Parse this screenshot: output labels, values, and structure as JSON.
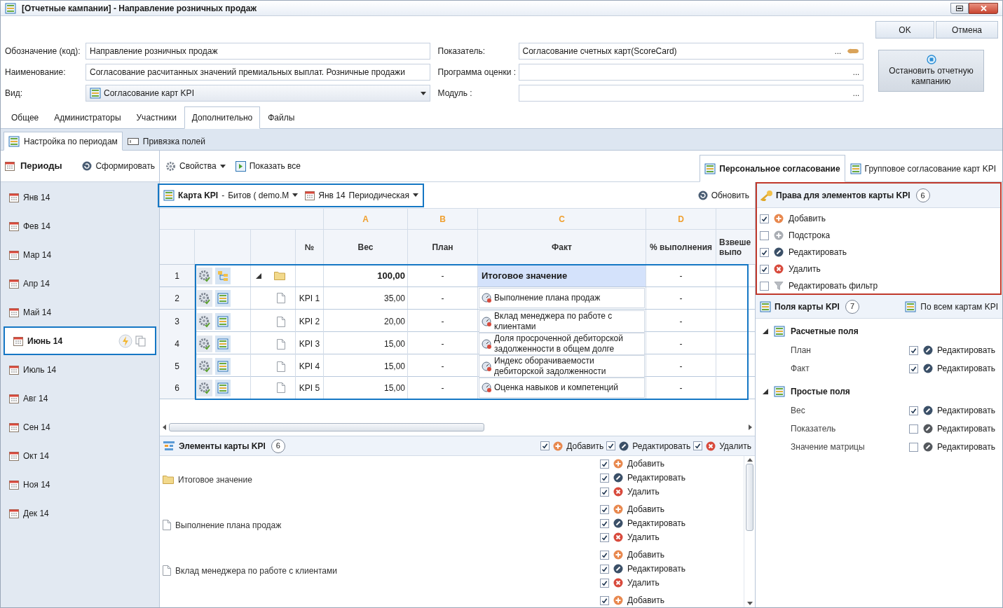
{
  "window": {
    "title": "[Отчетные кампании] - Направление розничных продаж"
  },
  "buttons": [
    {
      "label": "OK"
    },
    {
      "label": "Отмена"
    }
  ],
  "fields_left": [
    {
      "label": "Обозначение (код):",
      "value": "Направление розничных продаж",
      "kind": "text"
    },
    {
      "label": "Наименование:",
      "value": "Согласование расчитанных значений премиальных выплат. Розничные продажи",
      "kind": "text"
    },
    {
      "label": "Вид:",
      "value": "Согласование карт KPI",
      "kind": "select"
    }
  ],
  "fields_right": [
    {
      "label": "Показатель:",
      "value": "Согласование счетных карт(ScoreCard)",
      "kind": "lookup",
      "button": "...",
      "link_icon": true
    },
    {
      "label": "Программа оценки :",
      "kind": "lookup",
      "button": "..."
    },
    {
      "label": "Модуль :",
      "kind": "lookup",
      "button": "..."
    }
  ],
  "stop_button": {
    "label": "Остановить отчетную кампанию"
  },
  "tabs": [
    {
      "label": "Общее",
      "selected": false
    },
    {
      "label": "Администраторы",
      "selected": false
    },
    {
      "label": "Участники",
      "selected": false
    },
    {
      "label": "Дополнительно",
      "selected": true
    },
    {
      "label": "Файлы",
      "selected": false
    }
  ],
  "subtabs": [
    {
      "label": "Настройка по периодам",
      "selected": true
    },
    {
      "label": "Привязка полей",
      "selected": false
    }
  ],
  "periods_toolbar": {
    "title": "Периоды",
    "action": "Сформировать"
  },
  "toolbar": {
    "properties": "Свойства",
    "show_all": "Показать все"
  },
  "view_tabs": [
    {
      "label": "Персональное согласование",
      "selected": true
    },
    {
      "label": "Групповое согласование карт KPI",
      "selected": false
    }
  ],
  "periods": [
    {
      "label": "Янв 14",
      "selected": false
    },
    {
      "label": "Фев 14",
      "selected": false
    },
    {
      "label": "Мар 14",
      "selected": false
    },
    {
      "label": "Апр 14",
      "selected": false
    },
    {
      "label": "Май 14",
      "selected": false
    },
    {
      "label": "Июнь 14",
      "selected": true
    },
    {
      "label": "Июль 14",
      "selected": false
    },
    {
      "label": "Авг 14",
      "selected": false
    },
    {
      "label": "Сен 14",
      "selected": false
    },
    {
      "label": "Окт 14",
      "selected": false
    },
    {
      "label": "Ноя 14",
      "selected": false
    },
    {
      "label": "Дек 14",
      "selected": false
    }
  ],
  "grid": {
    "card_label": "Карта KPI",
    "card_separator": "-",
    "card_value": "Битов ( demo.M",
    "period": "Янв 14",
    "period_type": "Периодическая",
    "refresh": "Обновить",
    "column_letters": [
      "A",
      "B",
      "C",
      "D"
    ],
    "columns": [
      "№",
      "Вес",
      "План",
      "Факт",
      "% выполнения",
      "Взвеше выпо"
    ],
    "rows": [
      {
        "num": "1",
        "kind": "group",
        "expanded": true,
        "code": "",
        "weight": "100,00",
        "plan": "-",
        "fact": "Итоговое значение",
        "percent": "-"
      },
      {
        "num": "2",
        "kind": "item",
        "code": "KPI 1",
        "weight": "35,00",
        "plan": "-",
        "fact": "Выполнение плана продаж",
        "percent": "-"
      },
      {
        "num": "3",
        "kind": "item",
        "code": "KPI 2",
        "weight": "20,00",
        "plan": "-",
        "fact": "Вклад менеджера по работе с клиентами",
        "percent": "-"
      },
      {
        "num": "4",
        "kind": "item",
        "code": "KPI 3",
        "weight": "15,00",
        "plan": "-",
        "fact": "Доля просроченной дебиторской задолженности в общем долге",
        "percent": "-"
      },
      {
        "num": "5",
        "kind": "item",
        "code": "KPI 4",
        "weight": "15,00",
        "plan": "-",
        "fact": "Индекс оборачиваемости дебиторской задолженности",
        "percent": "-"
      },
      {
        "num": "6",
        "kind": "item",
        "code": "KPI 5",
        "weight": "15,00",
        "plan": "-",
        "fact": "Оценка навыков и компетенций",
        "percent": "-"
      }
    ]
  },
  "elements": {
    "title": "Элементы карты KPI",
    "count": "6",
    "header_actions": [
      {
        "kind": "add",
        "label": "Добавить",
        "checked": true
      },
      {
        "kind": "edit",
        "label": "Редактировать",
        "checked": true
      },
      {
        "kind": "delete",
        "label": "Удалить",
        "checked": true
      }
    ],
    "items": [
      {
        "kind": "folder",
        "label": "Итоговое значение",
        "actions": [
          {
            "kind": "add",
            "label": "Добавить",
            "checked": true
          },
          {
            "kind": "edit",
            "label": "Редактировать",
            "checked": true
          },
          {
            "kind": "delete",
            "label": "Удалить",
            "checked": true
          }
        ]
      },
      {
        "kind": "document",
        "label": "Выполнение плана продаж",
        "actions": [
          {
            "kind": "add",
            "label": "Добавить",
            "checked": true
          },
          {
            "kind": "edit",
            "label": "Редактировать",
            "checked": true
          },
          {
            "kind": "delete",
            "label": "Удалить",
            "checked": true
          }
        ]
      },
      {
        "kind": "document",
        "label": "Вклад менеджера по работе с клиентами",
        "actions": [
          {
            "kind": "add",
            "label": "Добавить",
            "checked": true
          },
          {
            "kind": "edit",
            "label": "Редактировать",
            "checked": true
          },
          {
            "kind": "delete",
            "label": "Удалить",
            "checked": true
          }
        ]
      },
      {
        "actions": [
          {
            "kind": "add",
            "label": "Добавить",
            "checked": true
          }
        ]
      }
    ]
  },
  "rights": {
    "title": "Права для элементов карты KPI",
    "count": "6",
    "items": [
      {
        "kind": "add",
        "label": "Добавить",
        "checked": true
      },
      {
        "kind": "subrow",
        "label": "Подстрока",
        "checked": false
      },
      {
        "kind": "edit",
        "label": "Редактировать",
        "checked": true
      },
      {
        "kind": "delete",
        "label": "Удалить",
        "checked": true
      },
      {
        "kind": "filter",
        "label": "Редактировать фильтр",
        "checked": false
      }
    ]
  },
  "fields_panel": {
    "title": "Поля карты KPI",
    "count": "7",
    "all_cards": "По всем картам KPI",
    "groups": [
      {
        "label": "Расчетные поля",
        "expanded": true,
        "children": [
          {
            "label": "План",
            "checked": true,
            "action": "Редактировать"
          },
          {
            "label": "Факт",
            "checked": true,
            "action": "Редактировать"
          }
        ]
      },
      {
        "label": "Простые поля",
        "expanded": true,
        "children": [
          {
            "label": "Вес",
            "checked": true,
            "action": "Редактировать"
          },
          {
            "label": "Показатель",
            "checked": false,
            "action": "Редактировать"
          },
          {
            "label": "Значение матрицы",
            "checked": false,
            "action": "Редактировать"
          }
        ]
      }
    ]
  }
}
